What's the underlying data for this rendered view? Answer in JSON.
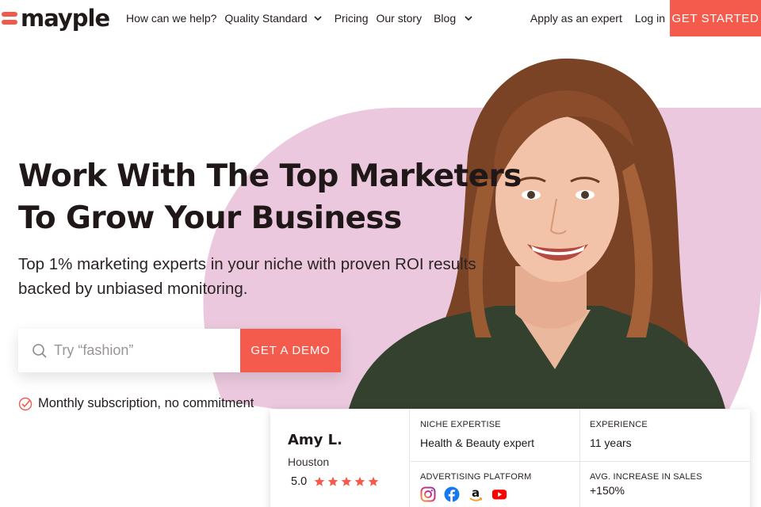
{
  "brand": {
    "logo_text": "mayple",
    "accent": "#f45b4c",
    "pink": "#ebc8dd"
  },
  "nav": {
    "items": [
      {
        "label": "How can we help?"
      },
      {
        "label": "Quality Standard",
        "dropdown": true
      },
      {
        "label": "Pricing"
      },
      {
        "label": "Our story"
      },
      {
        "label": "Blog",
        "dropdown": true
      }
    ],
    "apply_label": "Apply as an expert",
    "login_label": "Log in",
    "cta_label": "GET STARTED"
  },
  "hero": {
    "headline_line1": "Work With The Top Marketers",
    "headline_line2": "To Grow Your Business",
    "subline_line1": "Top 1% marketing experts in your niche with proven ROI results",
    "subline_line2": "backed by unbiased monitoring.",
    "search_placeholder": "Try “fashion”",
    "demo_label": "GET A DEMO",
    "note": "Monthly subscription, no commitment"
  },
  "profile_card": {
    "name": "Amy L.",
    "city": "Houston",
    "rating": "5.0",
    "stars": 5,
    "niche_label": "NICHE EXPERTISE",
    "niche_value": "Health & Beauty expert",
    "experience_label": "EXPERIENCE",
    "experience_value": "11 years",
    "platform_label": "ADVERTISING PLATFORM",
    "platforms": [
      "instagram-icon",
      "facebook-icon",
      "amazon-icon",
      "youtube-icon"
    ],
    "sales_label": "AVG. INCREASE IN SALES",
    "sales_value": "+150%"
  }
}
